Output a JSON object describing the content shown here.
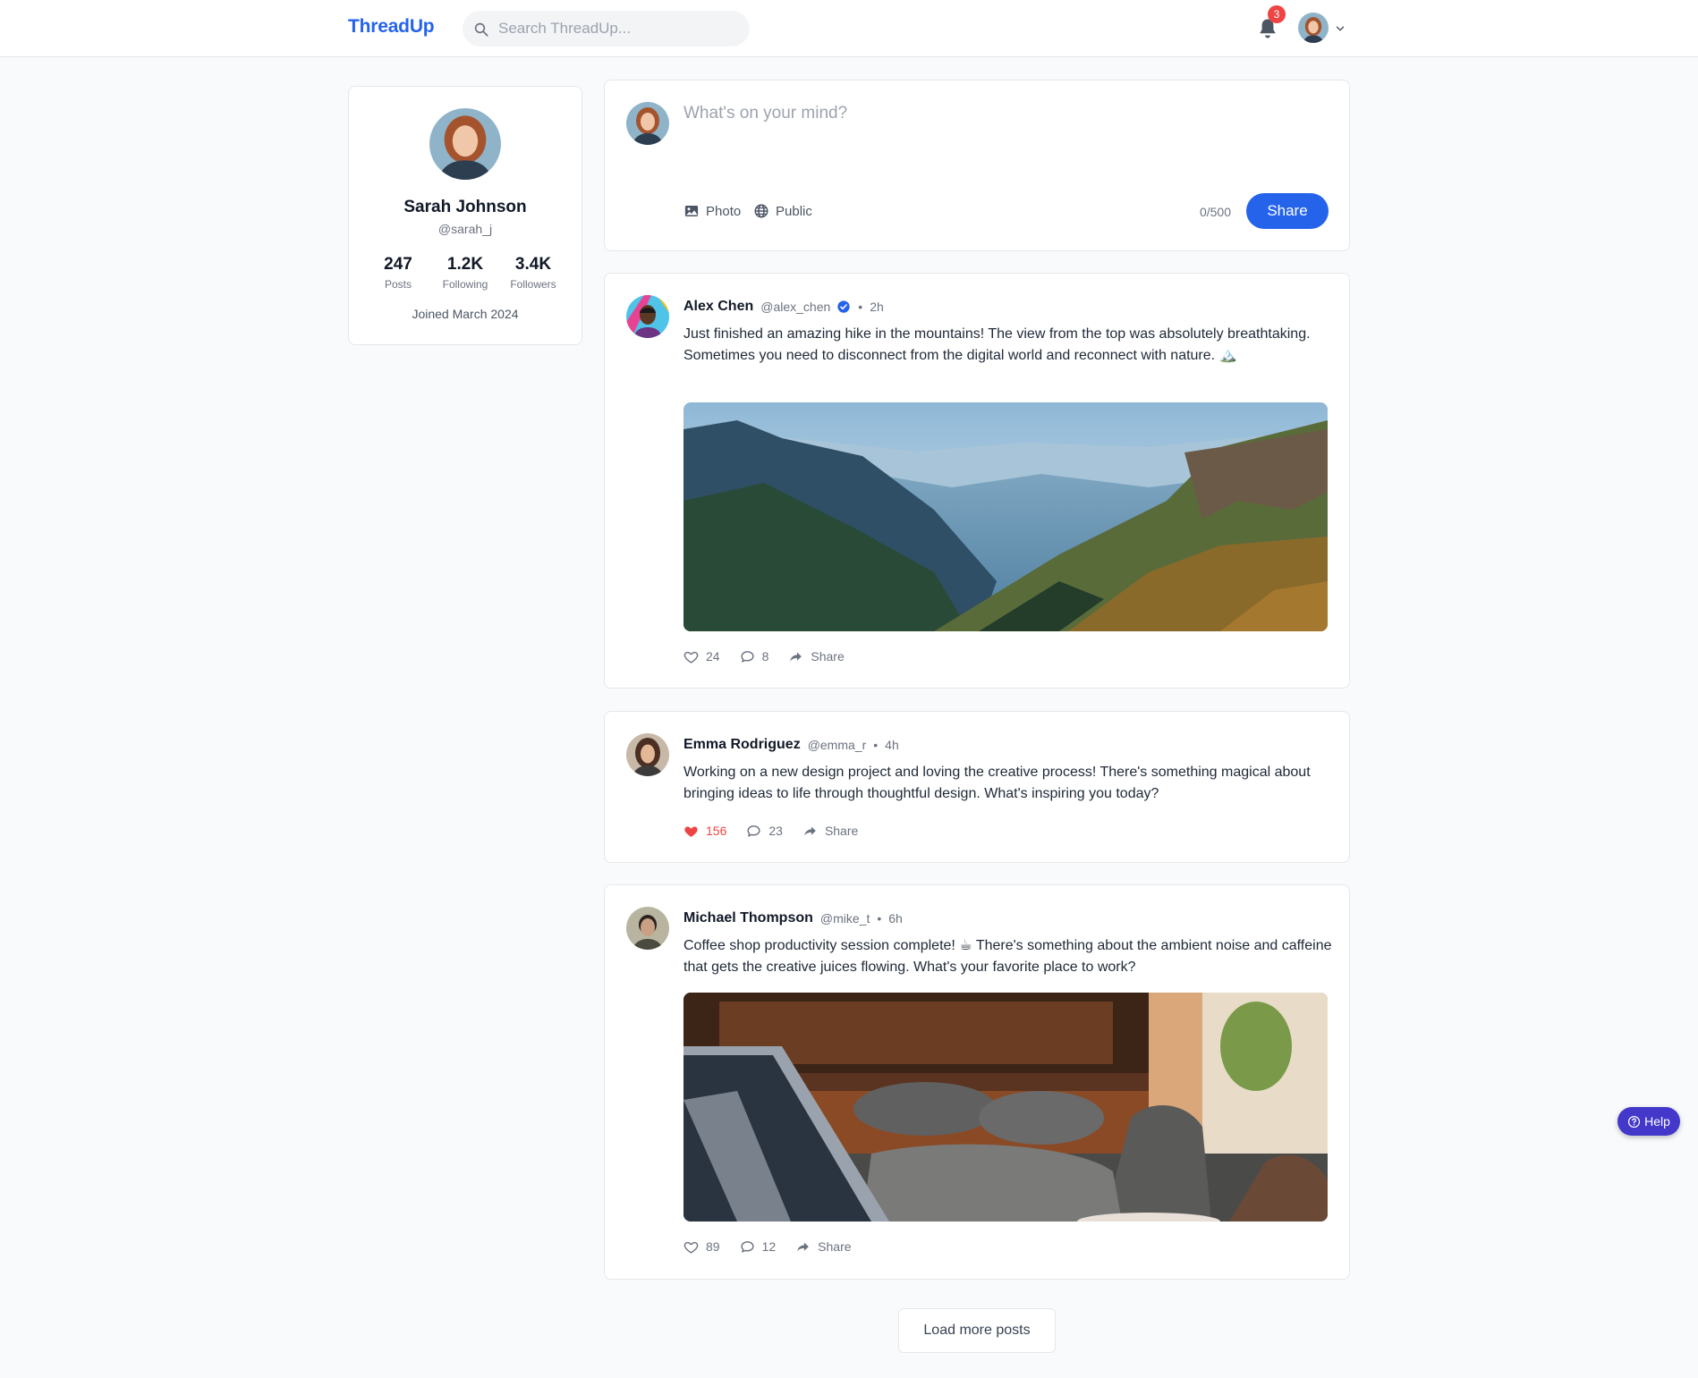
{
  "app": {
    "logo": "ThreadUp"
  },
  "search": {
    "placeholder": "Search ThreadUp..."
  },
  "header": {
    "notification_count": "3",
    "icons": [
      "search-icon",
      "bell-icon",
      "chevron-down-icon"
    ]
  },
  "profile": {
    "name": "Sarah Johnson",
    "handle": "@sarah_j",
    "stats": [
      {
        "value": "247",
        "label": "Posts"
      },
      {
        "value": "1.2K",
        "label": "Following"
      },
      {
        "value": "3.4K",
        "label": "Followers"
      }
    ],
    "joined": "Joined March 2024"
  },
  "composer": {
    "placeholder": "What's on your mind?",
    "photo_label": "Photo",
    "public_label": "Public",
    "counter": "0/500",
    "share_label": "Share"
  },
  "posts": [
    {
      "author": "Alex Chen",
      "handle": "@alex_chen",
      "verified": true,
      "time": "2h",
      "text": "Just finished an amazing hike in the mountains! The view from the top was absolutely breathtaking. Sometimes you need to disconnect from the digital world and reconnect with nature. 🏔️",
      "likes": "24",
      "liked": false,
      "comments": "8",
      "share_label": "Share"
    },
    {
      "author": "Emma Rodriguez",
      "handle": "@emma_r",
      "verified": false,
      "time": "4h",
      "text": "Working on a new design project and loving the creative process! There's something magical about bringing ideas to life through thoughtful design. What's inspiring you today?",
      "likes": "156",
      "liked": true,
      "comments": "23",
      "share_label": "Share"
    },
    {
      "author": "Michael Thompson",
      "handle": "@mike_t",
      "verified": false,
      "time": "6h",
      "text": "Coffee shop productivity session complete! ☕ There's something about the ambient noise and caffeine that gets the creative juices flowing. What's your favorite place to work?",
      "likes": "89",
      "liked": false,
      "comments": "12",
      "share_label": "Share"
    }
  ],
  "load_more_label": "Load more posts",
  "help_label": "Help",
  "colors": {
    "brand": "#2563eb",
    "like": "#ef4444",
    "help": "#4338ca",
    "background": "#f9fafb"
  }
}
